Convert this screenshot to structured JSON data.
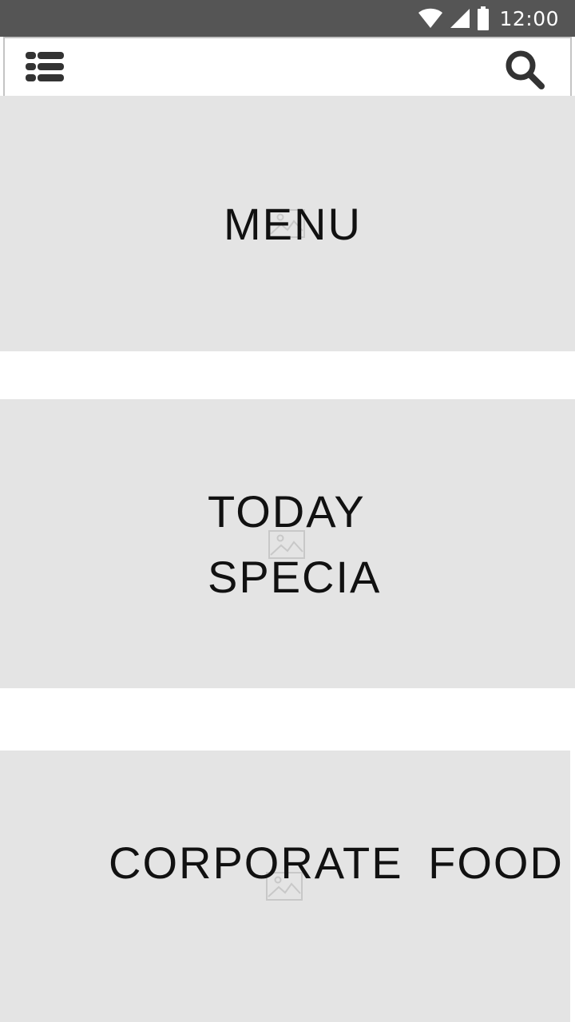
{
  "status_bar": {
    "time": "12:00",
    "icons": [
      "wifi-icon",
      "cellular-signal-icon",
      "battery-icon"
    ]
  },
  "toolbar": {
    "left_icon": "list-view-icon",
    "right_icon": "search-icon"
  },
  "tiles": [
    {
      "label": "MENU",
      "icon": "image-placeholder-icon"
    },
    {
      "label": "TODAY SPECIA",
      "icon": "image-placeholder-icon"
    },
    {
      "label": "CORPORATE FOOD",
      "icon": "image-placeholder-icon"
    }
  ],
  "colors": {
    "status_bar": "#555555",
    "tile_background": "#e4e4e4",
    "toolbar_border": "#c4c4c4",
    "icon": "#333333",
    "label_text": "#111111"
  }
}
